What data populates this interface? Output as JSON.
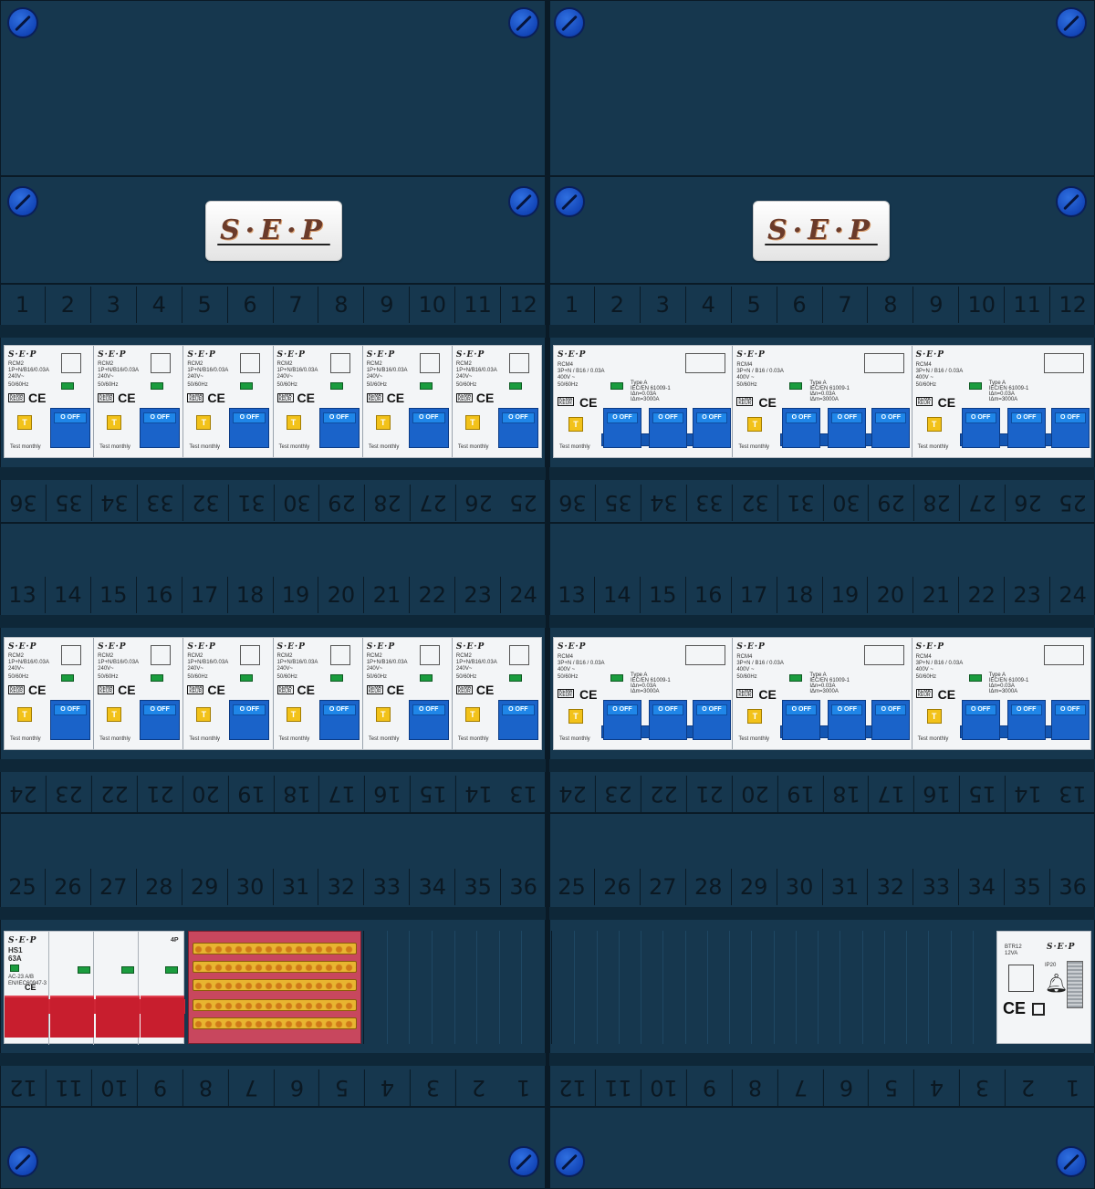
{
  "brand": "S·E·P",
  "top_numbers": [
    "1",
    "2",
    "3",
    "4",
    "5",
    "6",
    "7",
    "8",
    "9",
    "10",
    "11",
    "12"
  ],
  "row1_bottom_numbers": [
    "36",
    "35",
    "34",
    "33",
    "32",
    "31",
    "30",
    "29",
    "28",
    "27",
    "26",
    "25"
  ],
  "row2_top_numbers": [
    "13",
    "14",
    "15",
    "16",
    "17",
    "18",
    "19",
    "20",
    "21",
    "22",
    "23",
    "24"
  ],
  "row2_bottom_numbers": [
    "24",
    "23",
    "22",
    "21",
    "20",
    "19",
    "18",
    "17",
    "16",
    "15",
    "14",
    "13"
  ],
  "row3_top_numbers": [
    "25",
    "26",
    "27",
    "28",
    "29",
    "30",
    "31",
    "32",
    "33",
    "34",
    "35",
    "36"
  ],
  "row3_bottom_numbers": [
    "12",
    "11",
    "10",
    "9",
    "8",
    "7",
    "6",
    "5",
    "4",
    "3",
    "2",
    "1"
  ],
  "rcbo": {
    "model": "RCM2",
    "rating": "1P+N/B16/0.03A",
    "voltage": "240V~",
    "freq": "50/60Hz",
    "off": "O OFF",
    "test": "T",
    "test_text": "Test  monthly",
    "ce": "CE",
    "kema": "KEMA KEUR"
  },
  "rcm4": {
    "model": "RCM4",
    "rating": "3P+N / B16 / 0.03A",
    "voltage": "400V ~",
    "freq": "50/60Hz",
    "type": "Type A",
    "norm": "IEC/EN 61009-1",
    "idn": "IΔn=0.03A",
    "icn": "IΔm=3000A",
    "off": "O OFF",
    "test": "T",
    "test_text": "Test  monthly",
    "ce": "CE"
  },
  "main_switch": {
    "model": "HS1",
    "rating": "63A",
    "spec1": "AC-23 A/B",
    "spec2": "EN/IEC60947-3",
    "poles": "4P",
    "ce": "CE"
  },
  "transformer": {
    "model": "BTR12",
    "power": "12VA",
    "ip": "IP20",
    "ce": "CE"
  }
}
